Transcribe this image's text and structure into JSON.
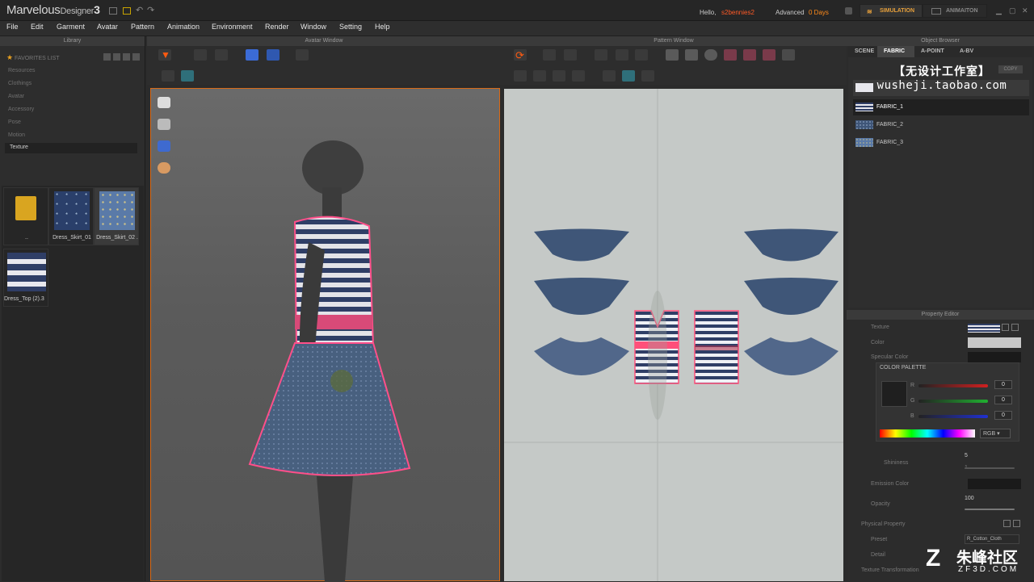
{
  "app": {
    "name": "Marvelous",
    "name_sub": "Designer",
    "version": "3"
  },
  "header": {
    "hello": "Hello,",
    "user": "s2bennies2",
    "license": "Advanced",
    "days": "0 Days",
    "sim_tab": "SIMULATION",
    "anim_tab": "ANIMAITON"
  },
  "menu": [
    "File",
    "Edit",
    "Garment",
    "Avatar",
    "Pattern",
    "Animation",
    "Environment",
    "Render",
    "Window",
    "Setting",
    "Help"
  ],
  "library": {
    "title": "Library",
    "favorite": "FAVORITES LIST",
    "tree": [
      "Resources",
      "Clothings",
      "Avatar",
      "Accessory",
      "Pose",
      "Motion"
    ],
    "selected": "Texture",
    "items": [
      {
        "label": ".."
      },
      {
        "label": "Dress_Skirt_01"
      },
      {
        "label": "Dress_Skirt_02 ."
      },
      {
        "label": "Dress_Top (2).3"
      }
    ]
  },
  "avatar_window": {
    "title": "Avatar Window"
  },
  "pattern_window": {
    "title": "Pattern Window"
  },
  "object_browser": {
    "title": "Object Browser",
    "tabs": [
      "SCENE",
      "FABRIC",
      "A-POINT",
      "A-BV"
    ],
    "copy_label": "COPY",
    "fabrics": [
      "FABRIC_1",
      "FABRIC_2",
      "FABRIC_3"
    ]
  },
  "watermark": {
    "line1": "【无设计工作室】",
    "line2": "wusheji.taobao.com",
    "bottom_cn": "朱峰社区",
    "bottom_en": "ZF3D.COM"
  },
  "property_editor": {
    "title": "Property Editor",
    "texture": "Texture",
    "color": "Color",
    "specular": "Specular Color",
    "palette": "COLOR PALETTE",
    "r": "R",
    "g": "G",
    "b": "B",
    "r_val": "0",
    "g_val": "0",
    "b_val": "0",
    "mode": "RGB",
    "shininess": "Shininess",
    "shininess_val": "5",
    "shininess_min": "1",
    "emission": "Emission Color",
    "opacity": "Opacity",
    "opacity_val": "100",
    "physical": "Physical Property",
    "preset": "Preset",
    "preset_val": "R_Cotton_Cloth",
    "detail": "Detail",
    "tex_transform": "Texture Transformation"
  },
  "colors": {
    "accent": "#ff8a1a",
    "pattern_bg": "#c5c9c7",
    "skirt_blue": "#3f5678",
    "stripe_pink": "#ff4f7a",
    "stripe_navy": "#2f3e66"
  }
}
